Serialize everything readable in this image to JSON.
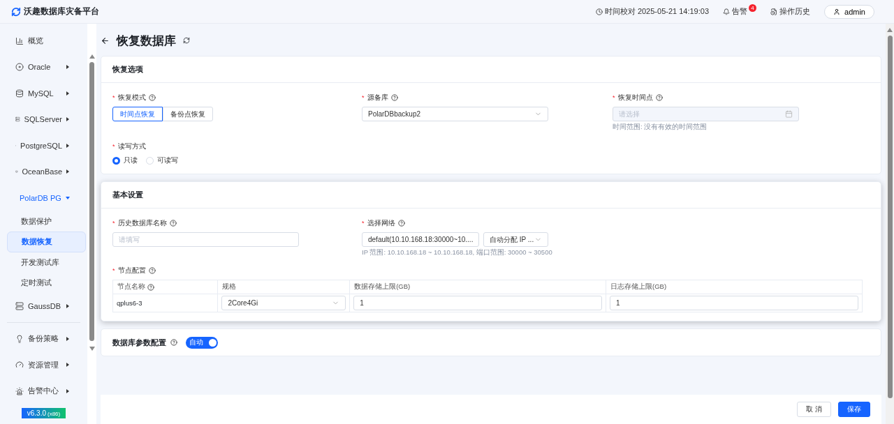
{
  "header": {
    "app_name": "沃趣数据库灾备平台",
    "time_check": "时间校对 2025-05-21 14:19:03",
    "alerts": {
      "label": "告警",
      "count": "4"
    },
    "history": "操作历史",
    "user": "admin"
  },
  "sidebar": {
    "sections": [
      [
        {
          "kind": "chart",
          "label": "概览",
          "has_caret": false,
          "expanded": false
        },
        {
          "kind": "oracle",
          "label": "Oracle",
          "has_caret": true,
          "expanded": false
        },
        {
          "kind": "mysql",
          "label": "MySQL",
          "has_caret": true,
          "expanded": false
        },
        {
          "kind": "sqlserver",
          "label": "SQLServer",
          "has_caret": true,
          "expanded": false
        },
        {
          "kind": "postgres",
          "label": "PostgreSQL",
          "has_caret": true,
          "expanded": false
        },
        {
          "kind": "ocean",
          "label": "OceanBase",
          "has_caret": true,
          "expanded": false
        },
        {
          "kind": "polar",
          "label": "PolarDB PG",
          "has_caret": true,
          "expanded": true,
          "children": [
            {
              "label": "数据保护",
              "selected": false
            },
            {
              "label": "数据恢复",
              "selected": true
            },
            {
              "label": "开发测试库",
              "selected": false
            },
            {
              "label": "定时测试",
              "selected": false
            }
          ]
        },
        {
          "kind": "gauss",
          "label": "GaussDB",
          "has_caret": true,
          "expanded": false
        }
      ],
      [
        {
          "kind": "policy",
          "label": "备份策略",
          "has_caret": true,
          "expanded": false
        },
        {
          "kind": "resource",
          "label": "资源管理",
          "has_caret": true,
          "expanded": false
        },
        {
          "kind": "alarm",
          "label": "告警中心",
          "has_caret": true,
          "expanded": false
        }
      ]
    ],
    "version": "v6.3.0",
    "version_arch": "(x86)"
  },
  "page": {
    "title": "恢复数据库"
  },
  "restore_options": {
    "title": "恢复选项",
    "mode": {
      "label": "恢复模式",
      "required_mark": "*",
      "options": [
        {
          "label": "时间点恢复",
          "selected": true
        },
        {
          "label": "备份点恢复",
          "selected": false
        }
      ]
    },
    "source": {
      "label": "源备库",
      "required_mark": "*",
      "value": "PolarDBbackup2"
    },
    "time_point": {
      "label": "恢复时间点",
      "required_mark": "*",
      "placeholder": "请选择",
      "disabled": true,
      "hint": "时间范围: 没有有效的时间范围"
    },
    "rw_mode": {
      "label": "读写方式",
      "required_mark": "*",
      "options": [
        {
          "label": "只读",
          "selected": true
        },
        {
          "label": "可读写",
          "selected": false
        }
      ]
    }
  },
  "basic_settings": {
    "title": "基本设置",
    "db_name": {
      "label": "历史数据库名称",
      "required_mark": "*",
      "placeholder": "请填写"
    },
    "network": {
      "label": "选择网络",
      "required_mark": "*",
      "value": "default(10.10.168.18:30000~10....",
      "ip_value": "自动分配 IP ...",
      "hint": "IP 范围: 10.10.168.18 ~ 10.10.168.18, 端口范围: 30000 ~ 30500"
    },
    "nodes": {
      "label": "节点配置",
      "required_mark": "*",
      "columns": [
        {
          "label": "节点名称",
          "help": true
        },
        {
          "label": "规格",
          "help": false
        },
        {
          "label": "数据存储上限(GB)",
          "help": false
        },
        {
          "label": "日志存储上限(GB)",
          "help": false
        }
      ],
      "rows": [
        {
          "name": "qplus6-3",
          "spec": "2Core4Gi",
          "data_limit": "1",
          "log_limit": "1"
        }
      ]
    }
  },
  "db_params": {
    "title": "数据库参数配置",
    "toggle": {
      "label": "自动",
      "on": true
    }
  },
  "footer": {
    "buttons": [
      {
        "label": "取 消",
        "kind": "default"
      },
      {
        "label": "保存",
        "kind": "primary"
      }
    ]
  }
}
